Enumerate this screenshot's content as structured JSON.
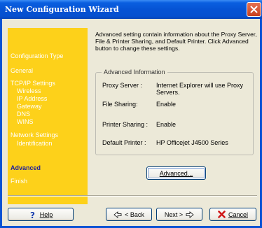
{
  "window": {
    "title": "New Configuration Wizard"
  },
  "sidebar": {
    "items": [
      {
        "label": "Configuration Type"
      },
      {
        "label": "General"
      },
      {
        "label": "TCP/IP Settings"
      },
      {
        "label": "Wireless"
      },
      {
        "label": "IP Address"
      },
      {
        "label": "Gateway"
      },
      {
        "label": "DNS"
      },
      {
        "label": "WINS"
      },
      {
        "label": "Network Settings"
      },
      {
        "label": "Identification"
      },
      {
        "label": "Advanced"
      },
      {
        "label": "Finish"
      }
    ]
  },
  "main": {
    "intro": "Advanced setting contain information about the Proxy Server, File & Printer Sharing, and Default Printer. Click Advanced button to change these settings.",
    "group_title": "Advanced Information",
    "rows": [
      {
        "label": "Proxy Server :",
        "value": "Internet Explorer will use Proxy Servers."
      },
      {
        "label": "File Sharing:",
        "value": "Enable"
      },
      {
        "label": "Printer Sharing :",
        "value": "Enable"
      },
      {
        "label": "Default Printer :",
        "value": "HP Officejet J4500 Series"
      }
    ],
    "advanced_button": "Advanced..."
  },
  "footer": {
    "help": "Help",
    "back": "< Back",
    "next": "Next >",
    "cancel": "Cancel"
  }
}
